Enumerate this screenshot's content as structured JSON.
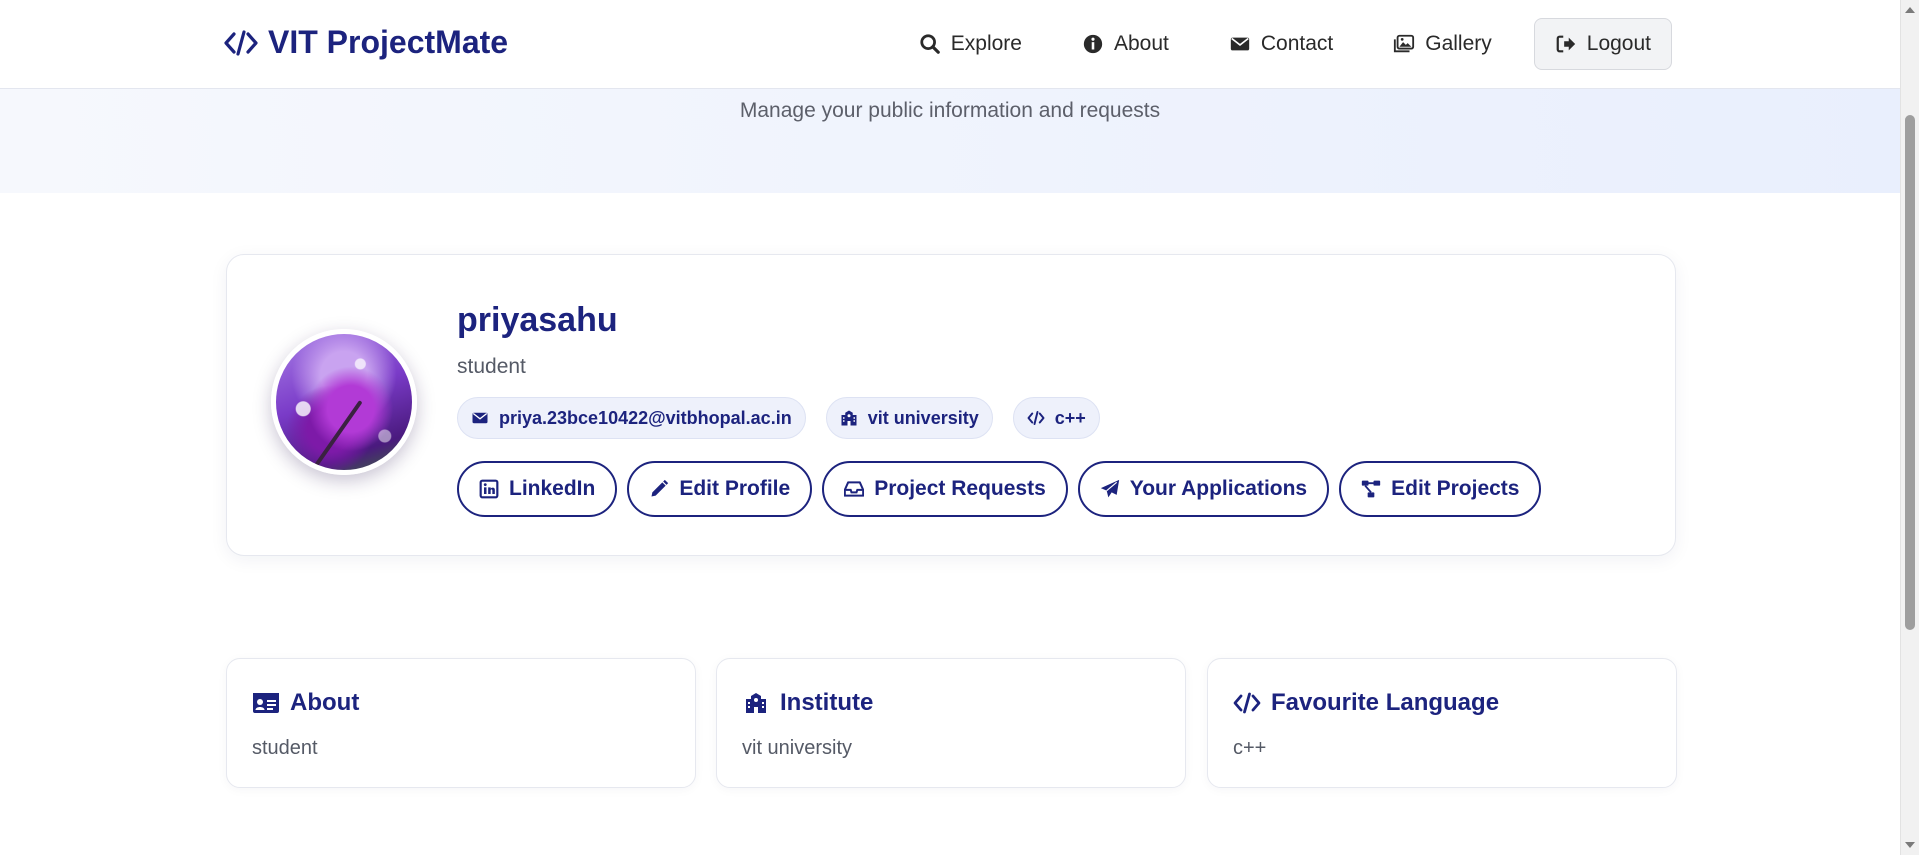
{
  "brand": {
    "title": "VIT ProjectMate",
    "icon": "code-icon"
  },
  "nav": {
    "explore": "Explore",
    "about": "About",
    "contact": "Contact",
    "gallery": "Gallery",
    "logout": "Logout"
  },
  "hero": {
    "subtitle": "Manage your public information and requests"
  },
  "profile": {
    "name": "priyasahu",
    "role": "student",
    "email": "priya.23bce10422@vitbhopal.ac.in",
    "institute": "vit university",
    "language": "c++"
  },
  "actions": {
    "linkedin": "LinkedIn",
    "edit_profile": "Edit Profile",
    "project_requests": "Project Requests",
    "your_applications": "Your Applications",
    "edit_projects": "Edit Projects"
  },
  "cards": {
    "about": {
      "title": "About",
      "value": "student"
    },
    "institute": {
      "title": "Institute",
      "value": "vit university"
    },
    "language": {
      "title": "Favourite Language",
      "value": "c++"
    }
  },
  "colors": {
    "primary": "#1c237e",
    "hero_start": "#f6f8fd",
    "hero_end": "#e9effd",
    "chip_bg": "#eef1fb"
  }
}
